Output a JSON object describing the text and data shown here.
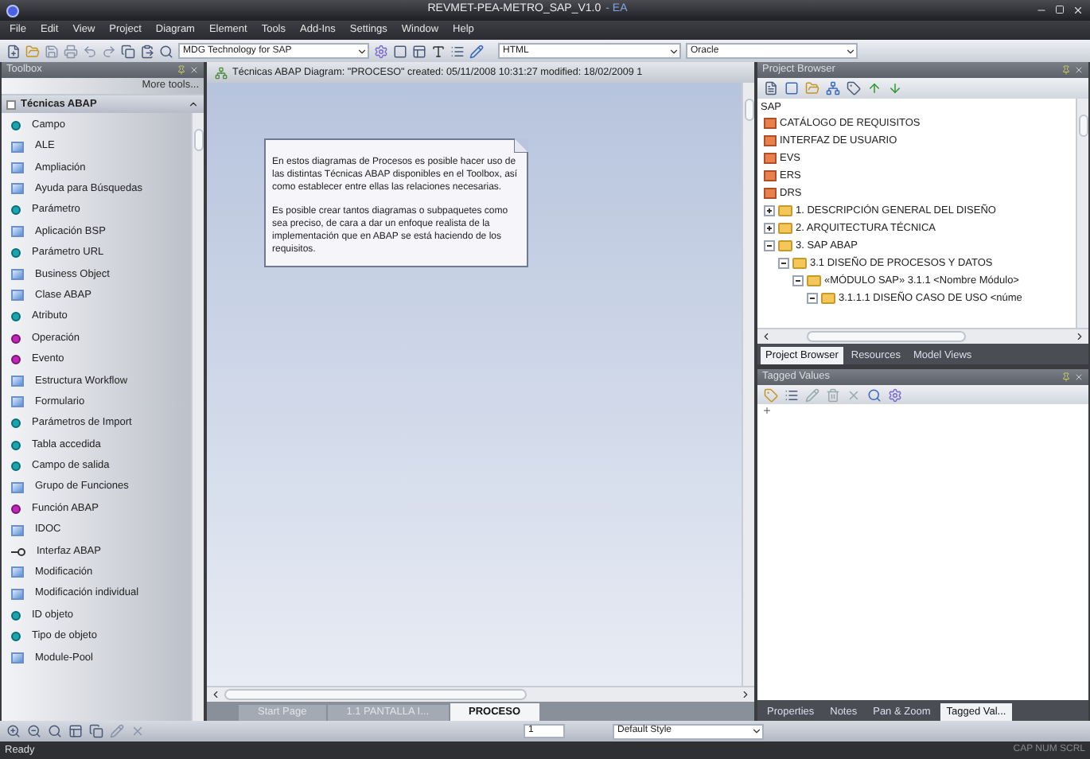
{
  "window": {
    "title": "REVMET-PEA-METRO_SAP_V1.0",
    "app": "- EA"
  },
  "menu": [
    "File",
    "Edit",
    "View",
    "Project",
    "Diagram",
    "Element",
    "Tools",
    "Add-Ins",
    "Settings",
    "Window",
    "Help"
  ],
  "toolbar": {
    "technology": "MDG Technology for SAP",
    "code_language": "HTML",
    "database": "Oracle"
  },
  "toolbox": {
    "title": "Toolbox",
    "more_tools": "More tools...",
    "group": "Técnicas ABAP",
    "expanded": true,
    "items": [
      {
        "label": "Campo",
        "kind": "attribute"
      },
      {
        "label": "ALE",
        "kind": "class"
      },
      {
        "label": "Ampliación",
        "kind": "class"
      },
      {
        "label": "Ayuda para Búsquedas",
        "kind": "class"
      },
      {
        "label": "Parámetro",
        "kind": "attribute"
      },
      {
        "label": "Aplicación BSP",
        "kind": "class"
      },
      {
        "label": "Parámetro URL",
        "kind": "attribute"
      },
      {
        "label": "Business Object",
        "kind": "class"
      },
      {
        "label": "Clase ABAP",
        "kind": "class"
      },
      {
        "label": "Atributo",
        "kind": "attribute"
      },
      {
        "label": "Operación",
        "kind": "operation"
      },
      {
        "label": "Evento",
        "kind": "operation"
      },
      {
        "label": "Estructura Workflow",
        "kind": "class"
      },
      {
        "label": "Formulario",
        "kind": "class"
      },
      {
        "label": "Parámetros de Import",
        "kind": "attribute"
      },
      {
        "label": "Tabla accedida",
        "kind": "attribute"
      },
      {
        "label": "Campo de salida",
        "kind": "attribute"
      },
      {
        "label": "Grupo de Funciones",
        "kind": "class"
      },
      {
        "label": "Función ABAP",
        "kind": "operation"
      },
      {
        "label": "IDOC",
        "kind": "class"
      },
      {
        "label": "Interfaz ABAP",
        "kind": "interface"
      },
      {
        "label": "Modificación",
        "kind": "class"
      },
      {
        "label": "Modificación individual",
        "kind": "class"
      },
      {
        "label": "ID objeto",
        "kind": "attribute"
      },
      {
        "label": "Tipo de objeto",
        "kind": "attribute"
      },
      {
        "label": "Module-Pool",
        "kind": "class"
      }
    ]
  },
  "diagram": {
    "header": "Técnicas ABAP Diagram: \"PROCESO\"  created: 05/11/2008 10:31:27  modified: 18/02/2009 1",
    "note": [
      "En estos diagramas de Procesos es posible hacer uso de las distintas Técnicas ABAP disponibles en el Toolbox, así como establecer entre ellas las relaciones necesarias.",
      "Es posible crear tantos diagramas o subpaquetes como sea preciso, de cara a dar un enfoque realista de la implementación que en ABAP se está haciendo de los requisitos."
    ],
    "tabs": [
      {
        "label": "Start Page",
        "selected": false
      },
      {
        "label": "1.1 PANTALLA I...",
        "selected": false
      },
      {
        "label": "PROCESO",
        "selected": true
      }
    ]
  },
  "project_browser": {
    "title": "Project Browser",
    "root": "SAP",
    "tree": [
      {
        "label": "CATÁLOGO DE REQUISITOS",
        "kind": "model"
      },
      {
        "label": "INTERFAZ DE USUARIO",
        "kind": "model"
      },
      {
        "label": "EVS",
        "kind": "model"
      },
      {
        "label": "ERS",
        "kind": "model"
      },
      {
        "label": "DRS",
        "kind": "model"
      },
      {
        "label": "1. DESCRIPCIÓN GENERAL DEL DISEÑO",
        "kind": "folder",
        "expanded": false
      },
      {
        "label": "2. ARQUITECTURA TÉCNICA",
        "kind": "folder",
        "expanded": false
      },
      {
        "label": "3. SAP ABAP",
        "kind": "folder",
        "expanded": true,
        "children": [
          {
            "label": "3.1 DISEÑO DE PROCESOS Y DATOS",
            "kind": "folder",
            "expanded": true,
            "children": [
              {
                "label": "«MÓDULO SAP» 3.1.1 <Nombre Módulo>",
                "kind": "folder",
                "expanded": true,
                "children": [
                  {
                    "label": "3.1.1.1 DISEÑO CASO DE USO <núme",
                    "kind": "folder",
                    "expanded": true
                  }
                ]
              }
            ]
          }
        ]
      }
    ],
    "tabs": [
      {
        "label": "Project Browser",
        "selected": true
      },
      {
        "label": "Resources",
        "selected": false
      },
      {
        "label": "Model Views",
        "selected": false
      }
    ]
  },
  "tagged_values": {
    "title": "Tagged Values",
    "tabs": [
      {
        "label": "Properties",
        "selected": false
      },
      {
        "label": "Notes",
        "selected": false
      },
      {
        "label": "Pan & Zoom",
        "selected": false
      },
      {
        "label": "Tagged Val...",
        "selected": true
      }
    ]
  },
  "bottom_toolbar": {
    "page": "1",
    "style": "Default Style"
  },
  "status_bar": {
    "message": "Ready",
    "keys": "CAP NUM SCRL"
  }
}
